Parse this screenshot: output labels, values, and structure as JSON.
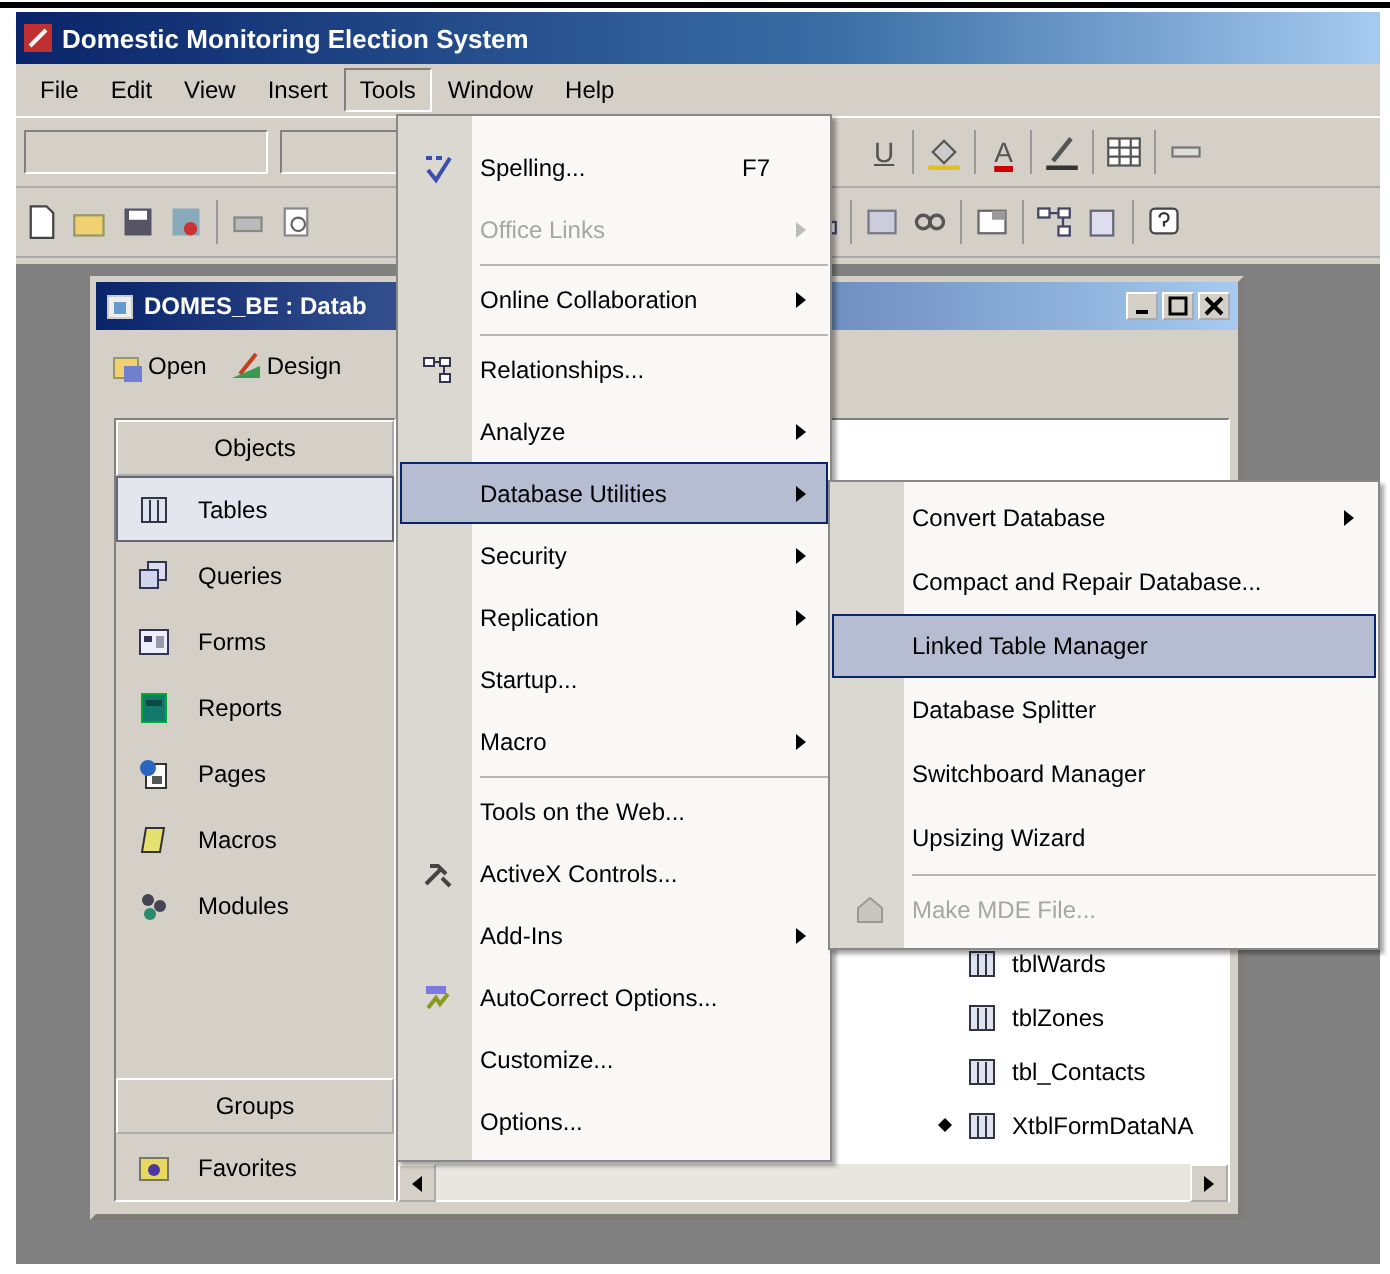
{
  "window": {
    "title": "Domestic Monitoring Election System"
  },
  "menubar": [
    {
      "label": "File",
      "selected": false
    },
    {
      "label": "Edit",
      "selected": false
    },
    {
      "label": "View",
      "selected": false
    },
    {
      "label": "Insert",
      "selected": false
    },
    {
      "label": "Tools",
      "selected": true
    },
    {
      "label": "Window",
      "selected": false
    },
    {
      "label": "Help",
      "selected": false
    }
  ],
  "format_toolbar": {
    "underline": "U",
    "font_color": "A"
  },
  "database_window": {
    "title": "DOMES_BE : Datab",
    "toolbar": [
      {
        "label": "Open"
      },
      {
        "label": "Design"
      }
    ],
    "objects_header": "Objects",
    "objects": [
      {
        "label": "Tables",
        "selected": true
      },
      {
        "label": "Queries",
        "selected": false
      },
      {
        "label": "Forms",
        "selected": false
      },
      {
        "label": "Reports",
        "selected": false
      },
      {
        "label": "Pages",
        "selected": false
      },
      {
        "label": "Macros",
        "selected": false
      },
      {
        "label": "Modules",
        "selected": false
      }
    ],
    "groups_header": "Groups",
    "groups": [
      {
        "label": "Favorites"
      }
    ],
    "list": [
      {
        "label": "tblWards",
        "pointer": false
      },
      {
        "label": "tblZones",
        "pointer": false
      },
      {
        "label": "tbl_Contacts",
        "pointer": false
      },
      {
        "label": "XtblFormDataNA",
        "pointer": true
      }
    ]
  },
  "tools_menu": [
    {
      "kind": "item",
      "label": "Spelling...",
      "shortcut": "F7",
      "submenu": false,
      "disabled": false,
      "selected": false
    },
    {
      "kind": "item",
      "label": "Office Links",
      "submenu": true,
      "disabled": true,
      "selected": false
    },
    {
      "kind": "separator"
    },
    {
      "kind": "item",
      "label": "Online Collaboration",
      "submenu": true,
      "disabled": false,
      "selected": false
    },
    {
      "kind": "separator"
    },
    {
      "kind": "item",
      "label": "Relationships...",
      "submenu": false,
      "disabled": false,
      "selected": false
    },
    {
      "kind": "item",
      "label": "Analyze",
      "submenu": true,
      "disabled": false,
      "selected": false
    },
    {
      "kind": "item",
      "label": "Database Utilities",
      "submenu": true,
      "disabled": false,
      "selected": true
    },
    {
      "kind": "item",
      "label": "Security",
      "submenu": true,
      "disabled": false,
      "selected": false
    },
    {
      "kind": "item",
      "label": "Replication",
      "submenu": true,
      "disabled": false,
      "selected": false
    },
    {
      "kind": "item",
      "label": "Startup...",
      "submenu": false,
      "disabled": false,
      "selected": false
    },
    {
      "kind": "item",
      "label": "Macro",
      "submenu": true,
      "disabled": false,
      "selected": false
    },
    {
      "kind": "separator"
    },
    {
      "kind": "item",
      "label": "Tools on the Web...",
      "submenu": false,
      "disabled": false,
      "selected": false
    },
    {
      "kind": "item",
      "label": "ActiveX Controls...",
      "submenu": false,
      "disabled": false,
      "selected": false
    },
    {
      "kind": "item",
      "label": "Add-Ins",
      "submenu": true,
      "disabled": false,
      "selected": false
    },
    {
      "kind": "item",
      "label": "AutoCorrect Options...",
      "submenu": false,
      "disabled": false,
      "selected": false
    },
    {
      "kind": "item",
      "label": "Customize...",
      "submenu": false,
      "disabled": false,
      "selected": false
    },
    {
      "kind": "item",
      "label": "Options...",
      "submenu": false,
      "disabled": false,
      "selected": false
    }
  ],
  "utilities_submenu": [
    {
      "kind": "item",
      "label": "Convert Database",
      "submenu": true,
      "disabled": false,
      "selected": false
    },
    {
      "kind": "item",
      "label": "Compact and Repair Database...",
      "submenu": false,
      "disabled": false,
      "selected": false
    },
    {
      "kind": "item",
      "label": "Linked Table Manager",
      "submenu": false,
      "disabled": false,
      "selected": true
    },
    {
      "kind": "item",
      "label": "Database Splitter",
      "submenu": false,
      "disabled": false,
      "selected": false
    },
    {
      "kind": "item",
      "label": "Switchboard Manager",
      "submenu": false,
      "disabled": false,
      "selected": false
    },
    {
      "kind": "item",
      "label": "Upsizing Wizard",
      "submenu": false,
      "disabled": false,
      "selected": false
    },
    {
      "kind": "separator"
    },
    {
      "kind": "item",
      "label": "Make MDE File...",
      "submenu": false,
      "disabled": true,
      "selected": false
    }
  ]
}
